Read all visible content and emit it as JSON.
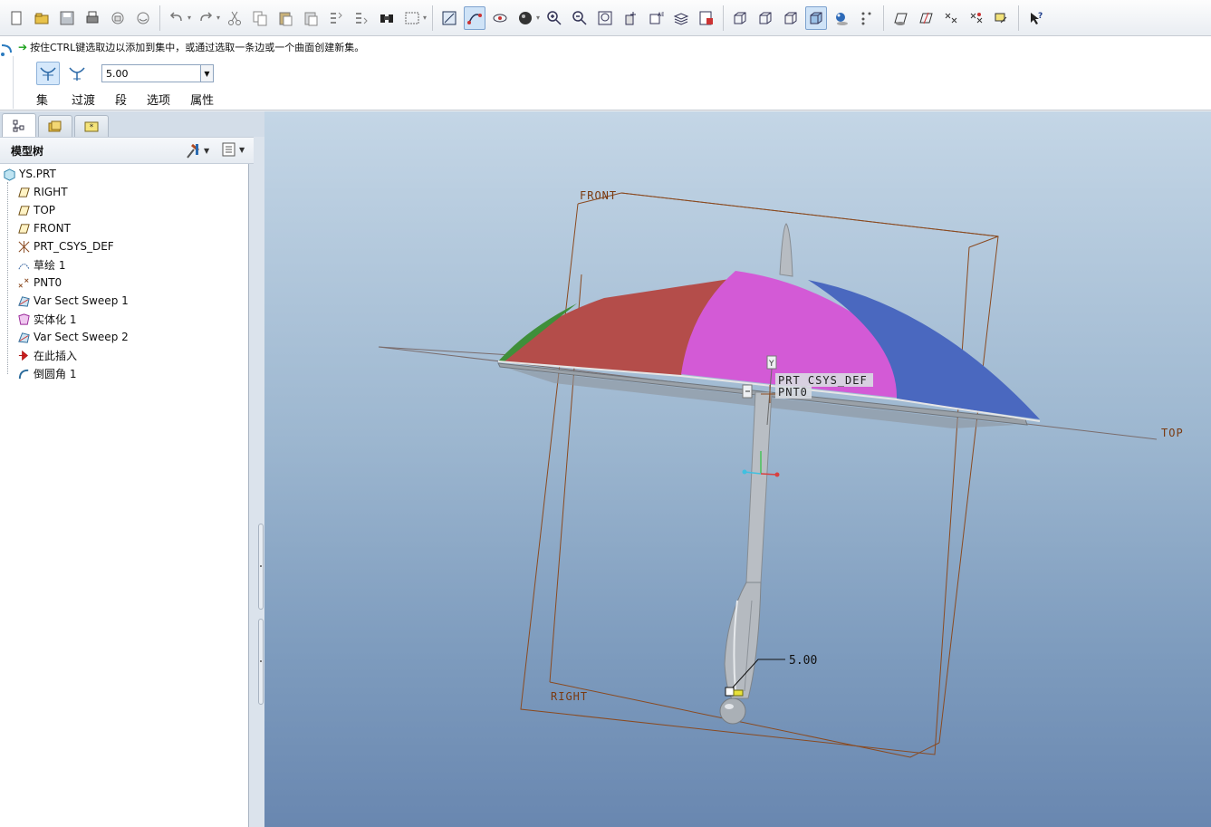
{
  "toolbar": {
    "groups": [
      [
        "new-icon",
        "open-icon",
        "save-icon",
        "print-icon",
        "send-mail-icon",
        "send-link-icon"
      ],
      [
        "undo-icon",
        "redo-icon",
        "cut-icon",
        "copy-icon",
        "paste-icon",
        "paste-special-icon",
        "regenerate-icon",
        "regenerate-manager-icon",
        "find-icon",
        "select-box-icon"
      ],
      [
        "sketch-plane-icon",
        "datum-curve-icon",
        "spin-center-icon",
        "shading-sphere-icon",
        "zoom-in-icon",
        "zoom-out-icon",
        "refit-icon",
        "reorient-icon",
        "saved-views-icon",
        "layers-icon",
        "view-manager-icon"
      ],
      [
        "wireframe-icon",
        "hidden-line-icon",
        "no-hidden-icon",
        "shading-icon",
        "enhanced-realism-icon",
        "csys-display-icon"
      ],
      [
        "datum-plane-display-icon",
        "datum-axis-display-icon",
        "point-display-icon",
        "csys-toggle-icon",
        "annotation-display-icon"
      ],
      [
        "whats-this-icon"
      ]
    ]
  },
  "dashboard": {
    "message": "按住CTRL键选取边以添加到集中，或通过选取一条边或一个曲面创建新集。",
    "radius_value": "5.00",
    "tabs": [
      "集",
      "过渡",
      "段",
      "选项",
      "属性"
    ]
  },
  "navigator": {
    "tree_title": "模型树",
    "root": "YS.PRT",
    "items": [
      {
        "label": "RIGHT",
        "icon": "datum-plane-icon"
      },
      {
        "label": "TOP",
        "icon": "datum-plane-icon"
      },
      {
        "label": "FRONT",
        "icon": "datum-plane-icon"
      },
      {
        "label": "PRT_CSYS_DEF",
        "icon": "coordinate-system-icon"
      },
      {
        "label": "草绘 1",
        "icon": "sketch-icon"
      },
      {
        "label": "PNT0",
        "icon": "datum-point-icon"
      },
      {
        "label": "Var Sect Sweep 1",
        "icon": "sweep-icon"
      },
      {
        "label": "实体化 1",
        "icon": "solidify-icon"
      },
      {
        "label": "Var Sect Sweep 2",
        "icon": "sweep-icon"
      },
      {
        "label": "在此插入",
        "icon": "insert-here-arrow-icon"
      },
      {
        "label": "倒圆角 1",
        "icon": "round-icon"
      }
    ]
  },
  "graphics": {
    "datum_labels": {
      "front": "FRONT",
      "top": "TOP",
      "right": "RIGHT"
    },
    "csys_label": "PRT_CSYS_DEF",
    "point_label": "PNT0",
    "axis_y_label": "Y",
    "dimension": "5.00",
    "colors": {
      "red_panel": "#b44d4a",
      "magenta_panel": "#d35ad6",
      "blue_panel": "#4a68bf",
      "green_edge": "#3f8f3a",
      "datum": "#8a4a20",
      "shaft": "#b9bec4"
    }
  }
}
